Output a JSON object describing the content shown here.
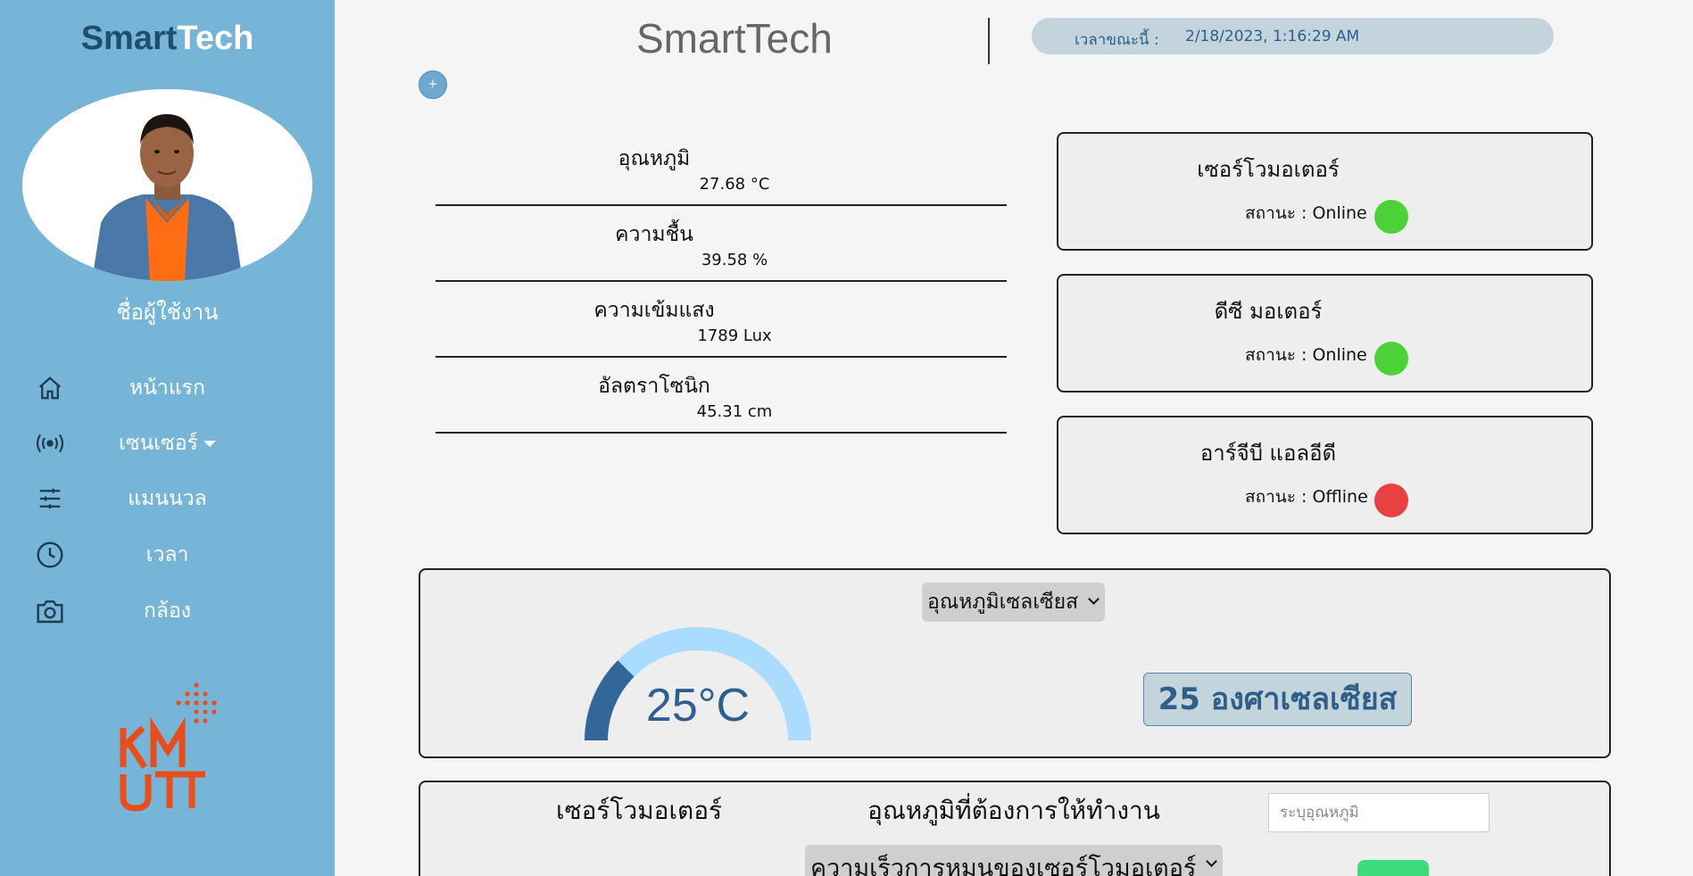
{
  "brand": {
    "part1": "Smart",
    "part2": "Tech"
  },
  "sidebar": {
    "username": "ชื่อผู้ใช้งาน",
    "items": [
      {
        "label": "หน้าแรก",
        "icon": "home-icon"
      },
      {
        "label": "เซนเซอร์",
        "icon": "broadcast-icon"
      },
      {
        "label": "แมนนวล",
        "icon": "sliders-icon"
      },
      {
        "label": "เวลา",
        "icon": "clock-icon"
      },
      {
        "label": "กล้อง",
        "icon": "camera-icon"
      }
    ],
    "logo": "KMUTT"
  },
  "header": {
    "title": "SmartTech",
    "time_label": "เวลาขณะนี้ :",
    "time_value": "2/18/2023, 1:16:29 AM",
    "plus_label": "+"
  },
  "readings": [
    {
      "name": "อุณหภูมิ",
      "value": "27.68 °C"
    },
    {
      "name": "ความชื้น",
      "value": "39.58 %"
    },
    {
      "name": "ความเข้มแสง",
      "value": "1789 Lux"
    },
    {
      "name": "อัลตราโซนิก",
      "value": "45.31 cm"
    }
  ],
  "devices": [
    {
      "name": "เซอร์โวมอเตอร์",
      "status": "สถานะ : Online",
      "color": "#4cd137"
    },
    {
      "name": "ดีซี มอเตอร์",
      "status": "สถานะ : Online",
      "color": "#4cd137"
    },
    {
      "name": "อาร์จีบี แอลอีดี",
      "status": "สถานะ : Offline",
      "color": "#e84141"
    }
  ],
  "gauge_panel": {
    "select_value": "อุณหภูมิเซลเซียส",
    "gauge_text": "25°C",
    "gauge_fraction": 0.25,
    "badge_text": "25 องศาเซลเซียส",
    "colors": {
      "fill": "#336699",
      "track": "#aadcff"
    }
  },
  "control_panel": {
    "device_label": "เซอร์โวมอเตอร์",
    "temp_label": "อุณหภูมิที่ต้องการให้ทำงาน",
    "temp_placeholder": "ระบุอุณหภูมิ",
    "speed_select": "ความเร็วการหมุนของเซอร์โวมอเตอร์"
  }
}
